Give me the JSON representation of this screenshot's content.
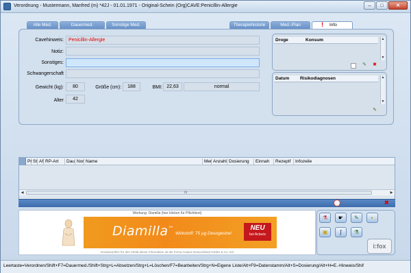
{
  "window": {
    "title": "Verordnung - Mustermann, Manfred (m) *42J - 01.01.1971 - Original-Schein (Org)CAVE:Penicillin-Allergie",
    "minimize_label": "–",
    "maximize_label": "□",
    "close_label": "✕"
  },
  "tabs": {
    "left": [
      "Alle Med.",
      "Dauermed.",
      "Sonstige Med."
    ],
    "right": [
      "Therapiehistorie",
      "Med.-Plan",
      "Info"
    ],
    "alert_glyph": "!"
  },
  "info": {
    "cavehinweis_label": "Cavehinweis:",
    "cavehinweis_value": "Penicillin-Allergie",
    "notiz_label": "Notiz:",
    "notiz_value": "",
    "sonstiges_label": "Sonstiges:",
    "sonstiges_value": "",
    "schwangerschaft_label": "Schwangerschaft",
    "schwangerschaft_value": "",
    "gewicht_label": "Gewicht (kg):",
    "gewicht_value": "80",
    "groesse_label": "Größe (cm):",
    "groesse_value": "188",
    "bmi_label": "BMI:",
    "bmi_value": "22,63",
    "bmi_category": "normal",
    "alter_label": "Alter",
    "alter_value": "42"
  },
  "drogen": {
    "columns": [
      "Droge",
      "Konsum"
    ]
  },
  "risiko": {
    "columns": [
      "Datum",
      "Risikodiagnosen"
    ]
  },
  "medlist": {
    "columns": [
      "Pr",
      "St",
      "Af",
      "RP-Art",
      "Dau",
      "Nor",
      "Name",
      "Mer",
      "Anzahl",
      "Dosierung",
      "Einnah",
      "Rezeptf",
      "Infozeile"
    ],
    "scroll_grip": "III"
  },
  "ad": {
    "top_text": "Werbung: Diamilla (hier klicken für Pflichttext)",
    "brand": "Diamilla",
    "tm": "™",
    "sub": "Wirkstoff: 75 µg Desogestrel",
    "neu": "NEU",
    "neu_sub": "bei Actavis",
    "footer": "Verantwortlich für den Inhalt dieser Information ist die Firma Actavis Deutschland GmbH & Co. KG"
  },
  "tools": {
    "ifox_label": "i:fox"
  },
  "statusbar": {
    "text": "Leertaste=Verordnen/Shift+F7=Dauermed./Shift+Strg+L=Absetzen/Strg+L=Löschen/F7=Bearbeiten/Strg+N=Eigene Liste/Alt+F9=Datenstamm/Alt+S=Dosierung/Alt+H=E.-Hinweis/Shif"
  },
  "colors": {
    "accent_blue": "#4a7ab8",
    "alert_red": "#e00000",
    "ad_orange": "#f28a1a"
  }
}
